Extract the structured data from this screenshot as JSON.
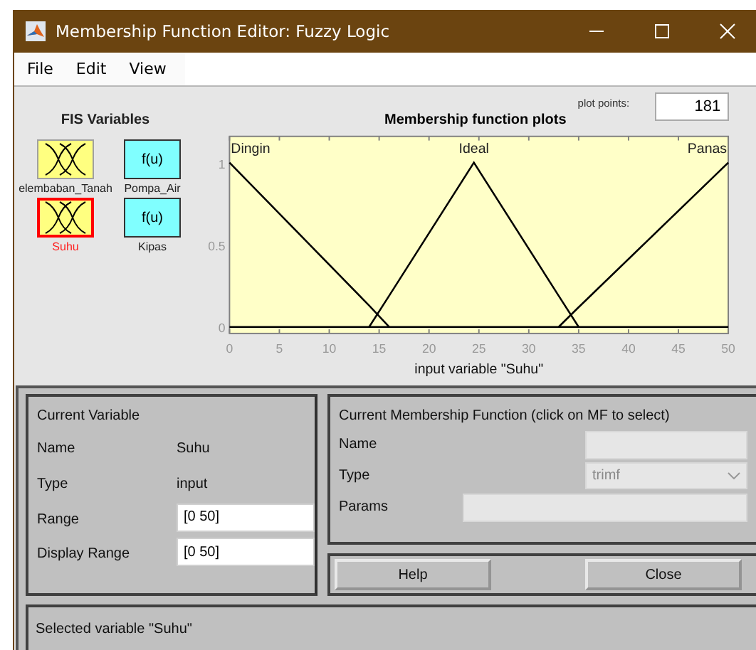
{
  "window": {
    "title": "Membership Function Editor: Fuzzy Logic"
  },
  "menu": [
    "File",
    "Edit",
    "View"
  ],
  "fis_variables": {
    "title": "FIS Variables",
    "items": [
      {
        "label": "elembaban_Tanah",
        "kind": "input",
        "selected": false
      },
      {
        "label": "Pompa_Air",
        "kind": "output",
        "icon_text": "f(u)",
        "selected": false
      },
      {
        "label": "Suhu",
        "kind": "input",
        "selected": true
      },
      {
        "label": "Kipas",
        "kind": "output",
        "icon_text": "f(u)",
        "selected": false
      }
    ]
  },
  "plot": {
    "plot_points_label": "plot points:",
    "plot_points": "181",
    "chart_data": {
      "type": "line",
      "title": "Membership function plots",
      "xlabel": "input variable \"Suhu\"",
      "x": [
        0,
        14,
        16,
        24.5,
        33,
        35,
        50
      ],
      "series": [
        {
          "name": "Dingin",
          "color": "#000000",
          "values": [
            1,
            0.13,
            0,
            null,
            null,
            null,
            null
          ]
        },
        {
          "name": "Ideal",
          "color": "#000000",
          "values": [
            null,
            0,
            0.19,
            1,
            0.19,
            0,
            null
          ]
        },
        {
          "name": "Panas",
          "color": "#000000",
          "values": [
            null,
            null,
            null,
            null,
            0,
            0.12,
            1
          ]
        }
      ],
      "xlim": [
        0,
        50
      ],
      "ylim": [
        -0.04,
        1.16
      ],
      "xticks": [
        0,
        5,
        10,
        15,
        20,
        25,
        30,
        35,
        40,
        45,
        50
      ],
      "yticks": [
        0,
        0.5,
        1
      ]
    }
  },
  "current_variable": {
    "title": "Current Variable",
    "fields": [
      {
        "label": "Name",
        "kind": "text",
        "value": "Suhu"
      },
      {
        "label": "Type",
        "kind": "text",
        "value": "input"
      },
      {
        "label": "Range",
        "kind": "field",
        "value": "[0 50]"
      },
      {
        "label": "Display Range",
        "kind": "field",
        "value": "[0 50]"
      }
    ]
  },
  "current_mf": {
    "title": "Current Membership Function (click on MF to select)",
    "fields": [
      {
        "label": "Name",
        "kind": "field",
        "disabled": true
      },
      {
        "label": "Type",
        "kind": "dropdown",
        "value": "trimf",
        "disabled": true
      },
      {
        "label": "Params",
        "kind": "wide_field",
        "disabled": true
      }
    ]
  },
  "buttons": [
    "Help",
    "Close"
  ],
  "status": "Selected variable \"Suhu\""
}
